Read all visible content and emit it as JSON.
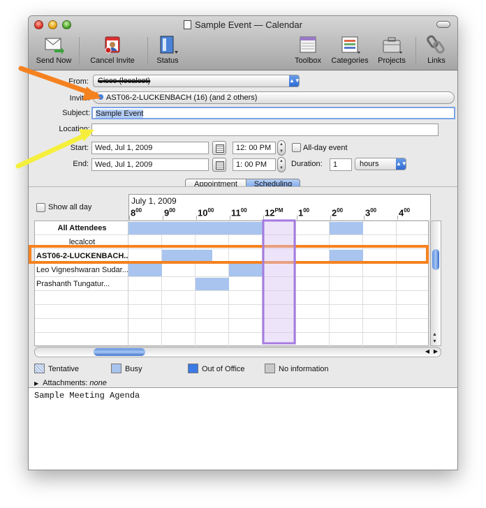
{
  "window": {
    "title": "Sample Event — Calendar"
  },
  "toolbar": {
    "send_now": "Send Now",
    "cancel_invite": "Cancel Invite",
    "status": "Status",
    "toolbox": "Toolbox",
    "categories": "Categories",
    "projects": "Projects",
    "links": "Links"
  },
  "form": {
    "from_label": "From:",
    "from_value": "Cisco (localcot)",
    "invite_label": "Invite:",
    "invite_value": "AST06-2-LUCKENBACH (16)  (and 2 others)",
    "subject_label": "Subject:",
    "subject_value": "Sample Event",
    "location_label": "Location:",
    "location_value": "",
    "start_label": "Start:",
    "start_date": "Wed, Jul 1, 2009",
    "start_time": "12: 00 PM",
    "allday_label": "All-day event",
    "end_label": "End:",
    "end_date": "Wed, Jul 1, 2009",
    "end_time": "1: 00 PM",
    "duration_label": "Duration:",
    "duration_value": "1",
    "duration_unit": "hours"
  },
  "tabs": {
    "appointment": "Appointment",
    "scheduling": "Scheduling"
  },
  "schedule": {
    "show_all_day": "Show all day",
    "date": "July 1, 2009",
    "hours": [
      {
        "n": "8",
        "s": "00"
      },
      {
        "n": "9",
        "s": "00"
      },
      {
        "n": "10",
        "s": "00"
      },
      {
        "n": "11",
        "s": "00"
      },
      {
        "n": "12",
        "s": "PM"
      },
      {
        "n": "1",
        "s": "00"
      },
      {
        "n": "2",
        "s": "00"
      },
      {
        "n": "3",
        "s": "00"
      },
      {
        "n": "4",
        "s": "00"
      }
    ],
    "attendees": [
      "All Attendees",
      "lecalcot",
      "AST06-2-LUCKENBACH...",
      "Leo Vigneshwaran Sudar...",
      "Prashanth Tungatur..."
    ],
    "busy_color": "#a8c4ef",
    "selection_color": "#a57be0",
    "highlight_color": "#f58220"
  },
  "legend": {
    "tentative": "Tentative",
    "busy": "Busy",
    "out_of_office": "Out of Office",
    "no_information": "No information"
  },
  "attachments": {
    "label": "Attachments:",
    "value": "none"
  },
  "notes": "Sample Meeting Agenda"
}
